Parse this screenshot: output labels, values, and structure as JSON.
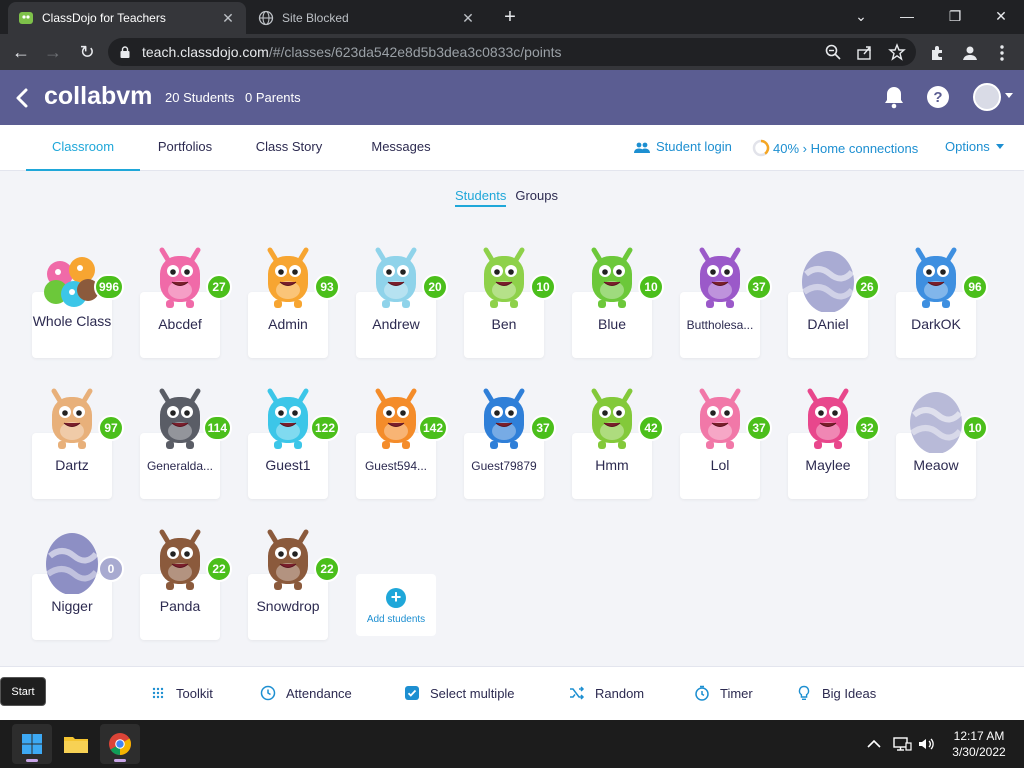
{
  "browser": {
    "tabs": [
      {
        "title": "ClassDojo for Teachers",
        "active": true
      },
      {
        "title": "Site Blocked",
        "active": false
      }
    ],
    "url_host": "teach.classdojo.com",
    "url_path": "/#/classes/623da542e8d5b3dea3c0833c/points"
  },
  "header": {
    "class_name": "collabvm",
    "students_count": "20 Students",
    "parents_count": "0 Parents"
  },
  "nav": {
    "tabs": [
      "Classroom",
      "Portfolios",
      "Class Story",
      "Messages"
    ],
    "active_tab": "Classroom",
    "student_login": "Student login",
    "home_connections": "40% › Home connections",
    "options": "Options"
  },
  "subtabs": {
    "students": "Students",
    "groups": "Groups"
  },
  "students": [
    {
      "name": "Whole Class",
      "points": "996",
      "kind": "group"
    },
    {
      "name": "Abcdef",
      "points": "27",
      "kind": "monster",
      "color": "#f06aa8"
    },
    {
      "name": "Admin",
      "points": "93",
      "kind": "monster",
      "color": "#f7a531"
    },
    {
      "name": "Andrew",
      "points": "20",
      "kind": "monster",
      "color": "#8fd3ea"
    },
    {
      "name": "Ben",
      "points": "10",
      "kind": "monster",
      "color": "#8ed14a"
    },
    {
      "name": "Blue",
      "points": "10",
      "kind": "monster",
      "color": "#6cc83a"
    },
    {
      "name": "Buttholesa...",
      "points": "37",
      "kind": "monster",
      "color": "#9b59c9"
    },
    {
      "name": "DAniel",
      "points": "26",
      "kind": "egg",
      "color": "#a9abd3"
    },
    {
      "name": "DarkOK",
      "points": "96",
      "kind": "monster",
      "color": "#3e8fe0"
    },
    {
      "name": "Dartz",
      "points": "97",
      "kind": "monster",
      "color": "#e8b07a"
    },
    {
      "name": "Generalda...",
      "points": "114",
      "kind": "monster",
      "color": "#5a5d66"
    },
    {
      "name": "Guest1",
      "points": "122",
      "kind": "monster",
      "color": "#3cc6e8"
    },
    {
      "name": "Guest594...",
      "points": "142",
      "kind": "monster",
      "color": "#f48c2a"
    },
    {
      "name": "Guest79879",
      "points": "37",
      "kind": "monster",
      "color": "#2f7fd8"
    },
    {
      "name": "Hmm",
      "points": "42",
      "kind": "monster",
      "color": "#83c93a"
    },
    {
      "name": "Lol",
      "points": "37",
      "kind": "monster",
      "color": "#f178a8"
    },
    {
      "name": "Maylee",
      "points": "32",
      "kind": "monster",
      "color": "#e8478c"
    },
    {
      "name": "Meaow",
      "points": "10",
      "kind": "egg",
      "color": "#b8bad8"
    },
    {
      "name": "Nigger",
      "points": "0",
      "kind": "egg",
      "color": "#8d8fc4"
    },
    {
      "name": "Panda",
      "points": "22",
      "kind": "monster",
      "color": "#8b5a3c"
    },
    {
      "name": "Snowdrop",
      "points": "22",
      "kind": "monster",
      "color": "#8b5a3c"
    }
  ],
  "add_students": "Add students",
  "toolbar": {
    "items": [
      "Toolkit",
      "Attendance",
      "Select multiple",
      "Random",
      "Timer",
      "Big Ideas"
    ]
  },
  "start_tooltip": "Start",
  "clock": {
    "time": "12:17 AM",
    "date": "3/30/2022"
  },
  "colors": {
    "header": "#5b5d92",
    "accent": "#1fa7d9",
    "badge": "#4bbf1b"
  }
}
